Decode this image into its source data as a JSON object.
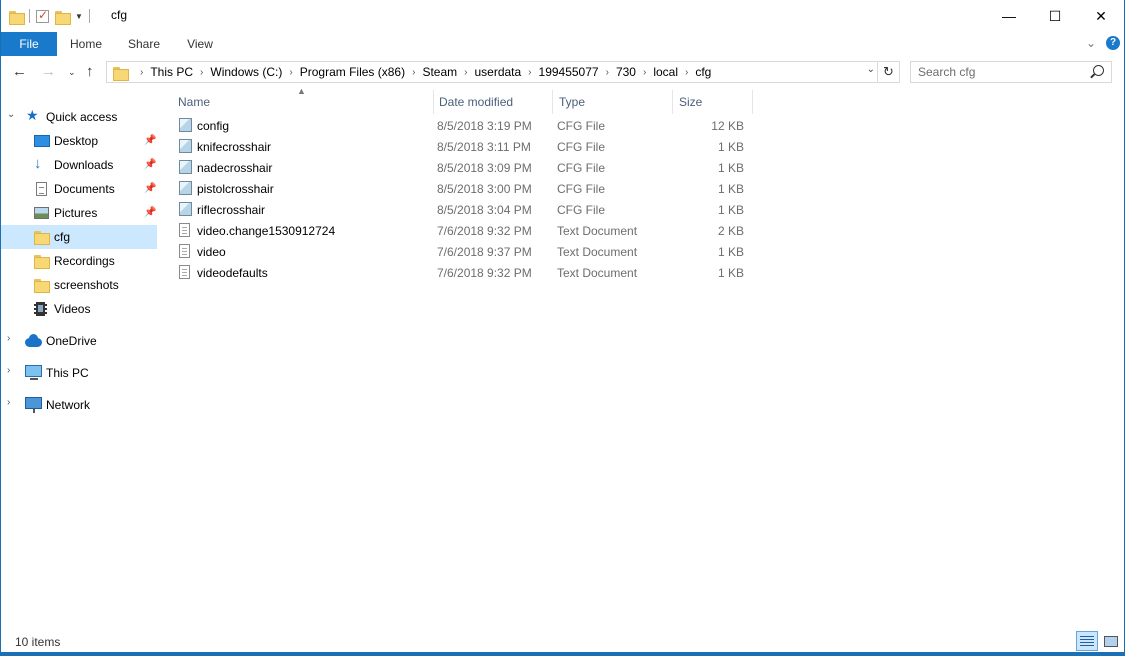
{
  "window": {
    "title": "cfg",
    "controls": {
      "minimize": "—",
      "maximize": "☐",
      "close": "✕"
    }
  },
  "ribbon": {
    "tabs": [
      "File",
      "Home",
      "Share",
      "View"
    ]
  },
  "address": {
    "breadcrumbs": [
      "This PC",
      "Windows (C:)",
      "Program Files (x86)",
      "Steam",
      "userdata",
      "199455077",
      "730",
      "local",
      "cfg"
    ]
  },
  "search": {
    "placeholder": "Search cfg"
  },
  "navpane": {
    "quick_access": "Quick access",
    "items": [
      {
        "label": "Desktop",
        "pinned": true,
        "icon": "desktop-icon"
      },
      {
        "label": "Downloads",
        "pinned": true,
        "icon": "downloads-icon"
      },
      {
        "label": "Documents",
        "pinned": true,
        "icon": "documents-icon"
      },
      {
        "label": "Pictures",
        "pinned": true,
        "icon": "pictures-icon"
      },
      {
        "label": "cfg",
        "pinned": false,
        "icon": "folder-icon",
        "selected": true
      },
      {
        "label": "Recordings",
        "pinned": false,
        "icon": "folder-icon"
      },
      {
        "label": "screenshots",
        "pinned": false,
        "icon": "folder-icon"
      },
      {
        "label": "Videos",
        "pinned": false,
        "icon": "videos-icon"
      }
    ],
    "roots": [
      "OneDrive",
      "This PC",
      "Network"
    ]
  },
  "columns": {
    "name": "Name",
    "date": "Date modified",
    "type": "Type",
    "size": "Size"
  },
  "files": [
    {
      "name": "config",
      "date": "8/5/2018 3:19 PM",
      "type": "CFG File",
      "size": "12 KB",
      "icon": "cfg-file-icon"
    },
    {
      "name": "knifecrosshair",
      "date": "8/5/2018 3:11 PM",
      "type": "CFG File",
      "size": "1 KB",
      "icon": "cfg-file-icon"
    },
    {
      "name": "nadecrosshair",
      "date": "8/5/2018 3:09 PM",
      "type": "CFG File",
      "size": "1 KB",
      "icon": "cfg-file-icon"
    },
    {
      "name": "pistolcrosshair",
      "date": "8/5/2018 3:00 PM",
      "type": "CFG File",
      "size": "1 KB",
      "icon": "cfg-file-icon"
    },
    {
      "name": "riflecrosshair",
      "date": "8/5/2018 3:04 PM",
      "type": "CFG File",
      "size": "1 KB",
      "icon": "cfg-file-icon"
    },
    {
      "name": "video.change1530912724",
      "date": "7/6/2018 9:32 PM",
      "type": "Text Document",
      "size": "2 KB",
      "icon": "text-file-icon"
    },
    {
      "name": "video",
      "date": "7/6/2018 9:37 PM",
      "type": "Text Document",
      "size": "1 KB",
      "icon": "text-file-icon"
    },
    {
      "name": "videodefaults",
      "date": "7/6/2018 9:32 PM",
      "type": "Text Document",
      "size": "1 KB",
      "icon": "text-file-icon"
    }
  ],
  "status": {
    "item_count": "10 items"
  },
  "colors": {
    "accent": "#1979ca",
    "selected": "#cce8ff",
    "header_text": "#4c607a"
  }
}
